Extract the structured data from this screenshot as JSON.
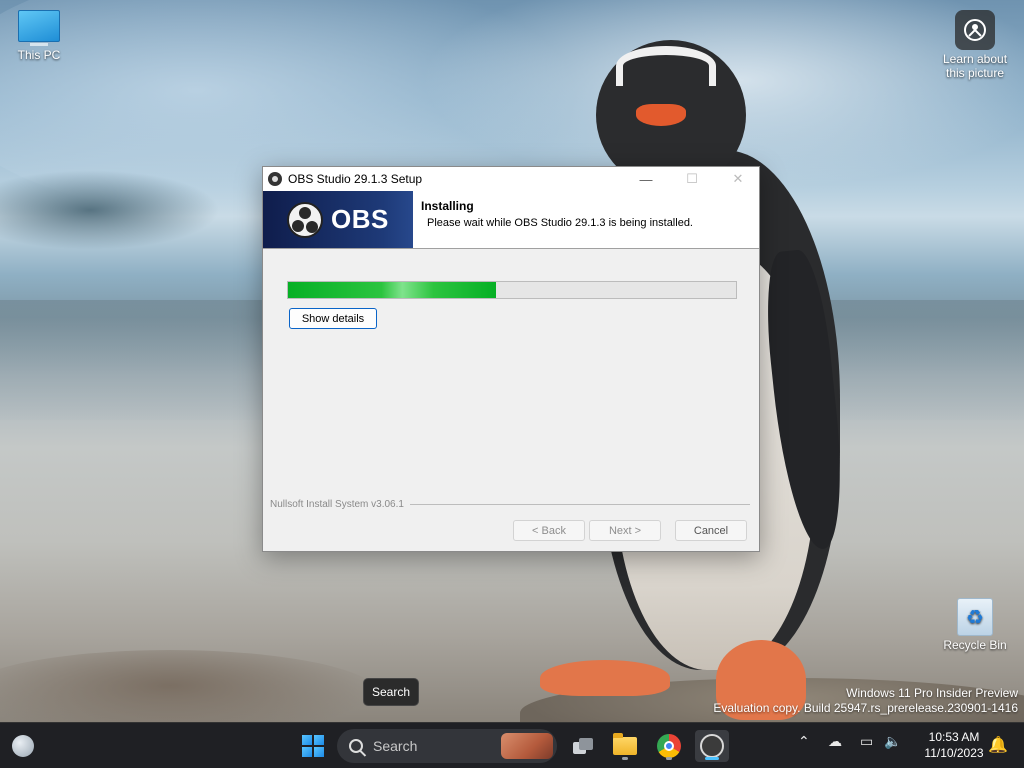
{
  "desktop": {
    "icons": {
      "this_pc": "This PC",
      "learn_line1": "Learn about",
      "learn_line2": "this picture",
      "recycle_bin": "Recycle Bin"
    },
    "watermark": {
      "line1": "Windows 11 Pro Insider Preview",
      "line2": "Evaluation copy. Build 25947.rs_prerelease.230901-1416"
    }
  },
  "installer": {
    "window_title": "OBS Studio 29.1.3 Setup",
    "controls": {
      "minimize": "—",
      "maximize": "☐",
      "close": "✕"
    },
    "banner_text": "OBS",
    "header_title": "Installing",
    "header_subtitle": "Please wait while OBS Studio 29.1.3 is being installed.",
    "progress_fraction": 0.465,
    "show_details_label": "Show details",
    "branding": "Nullsoft Install System v3.06.1",
    "buttons": {
      "back": "< Back",
      "next": "Next >",
      "cancel": "Cancel"
    }
  },
  "tooltip": "Search",
  "taskbar": {
    "search_placeholder": "Search",
    "pinned": [
      "weather-icon",
      "start-icon",
      "task-view-icon",
      "file-explorer-icon",
      "chrome-icon",
      "obs-icon"
    ],
    "tray_icons": [
      "chevron-up-icon",
      "cloud-off-icon",
      "display-icon",
      "speaker-icon"
    ],
    "time": "10:53 AM",
    "date": "11/10/2023"
  },
  "colors": {
    "accent": "#4cc2ff",
    "progress_green": "#06b025",
    "obs_banner": "#1e3a78",
    "taskbar": "#1f2024"
  }
}
